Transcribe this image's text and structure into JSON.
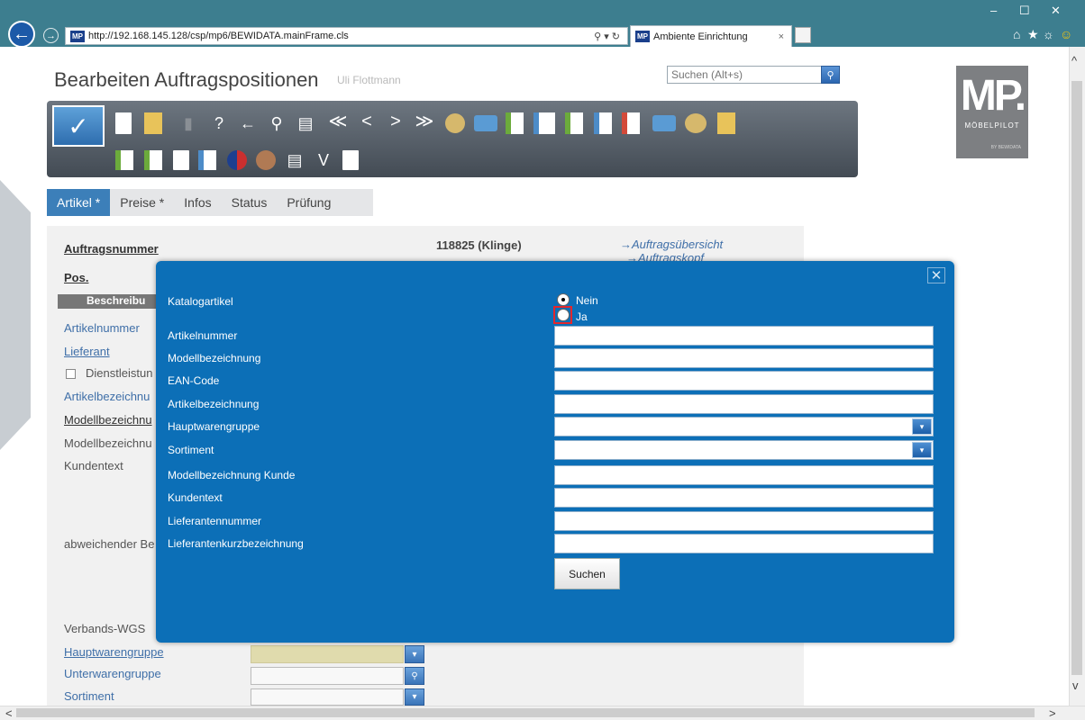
{
  "browser": {
    "url": "http://192.168.145.128/csp/mp6/BEWIDATA.mainFrame.cls",
    "url_controls": "⚲ ▾ ↻",
    "favicon_text": "MP",
    "tab_title": "Ambiente Einrichtung",
    "tab_close": "×",
    "back_glyph": "←",
    "forward_glyph": "→",
    "window_controls": {
      "minimize": "–",
      "maximize": "☐",
      "close": "✕"
    },
    "toolbar_icons": {
      "home": "⌂",
      "favorites": "★",
      "settings": "☼",
      "smiley": "☺"
    },
    "scroll_up": "^",
    "scroll_down": "v",
    "scroll_left": "<",
    "scroll_right": ">"
  },
  "page": {
    "title": "Bearbeiten Auftragspositionen",
    "user": "Uli Flottmann",
    "search_placeholder": "Suchen (Alt+s)",
    "search_glyph": "⚲",
    "save_glyph": "✓"
  },
  "logo": {
    "text": "MP.",
    "name": "MÖBELPILOT",
    "by": "BY BEWIDATA"
  },
  "toolbar": {
    "icon_glyphs": [
      "?",
      "←",
      "⚲",
      "≪",
      "<",
      ">",
      "≫",
      "✉",
      "V"
    ]
  },
  "tabs": [
    {
      "label": "Artikel *"
    },
    {
      "label": "Preise *"
    },
    {
      "label": "Infos"
    },
    {
      "label": "Status"
    },
    {
      "label": "Prüfung"
    }
  ],
  "form_bg": {
    "auftragsnummer_label": "Auftragsnummer",
    "auftragsnummer_value": "118825 (Klinge)",
    "link_overview": "→Auftragsübersicht",
    "link_head": "→Auftragskopf",
    "pos_label": "Pos.",
    "section_label": "Beschreibu",
    "artikelnummer": "Artikelnummer",
    "lieferant": "Lieferant",
    "dienstleistung": "Dienstleistun",
    "artikelbezeichnung": "Artikelbezeichnu",
    "modellbezeichnung_link": "Modellbezeichnu",
    "modellbezeichnung": "Modellbezeichnu",
    "kundentext": "Kundentext",
    "abweichender": "abweichender Be",
    "verbands_wgs": "Verbands-WGS",
    "hauptwarengruppe": "Hauptwarengruppe",
    "unterwarengruppe": "Unterwarengruppe",
    "sortiment": "Sortiment",
    "dropdown_glyph": "▾",
    "search_glyph": "⚲"
  },
  "dialog": {
    "close": "✕",
    "katalogartikel_label": "Katalogartikel",
    "radio_nein": "Nein",
    "radio_ja": "Ja",
    "selected": "Nein",
    "fields": [
      {
        "label": "Artikelnummer",
        "value": ""
      },
      {
        "label": "Modellbezeichnung",
        "value": ""
      },
      {
        "label": "EAN-Code",
        "value": ""
      },
      {
        "label": "Artikelbezeichnung",
        "value": ""
      },
      {
        "label": "Hauptwarengruppe",
        "value": ""
      },
      {
        "label": "Sortiment",
        "value": ""
      },
      {
        "label": "Modellbezeichnung Kunde",
        "value": ""
      },
      {
        "label": "Kundentext",
        "value": ""
      },
      {
        "label": "Lieferantennummer",
        "value": ""
      },
      {
        "label": "Lieferantenkurzbezeichnung",
        "value": ""
      }
    ],
    "dropdown_glyph": "▾",
    "search_button": "Suchen"
  },
  "colors": {
    "dialog_bg": "#0c6fb7",
    "active_tab": "#3c7fb9",
    "highlight": "#e3272c",
    "browser_bar": "#3d7e8f"
  }
}
